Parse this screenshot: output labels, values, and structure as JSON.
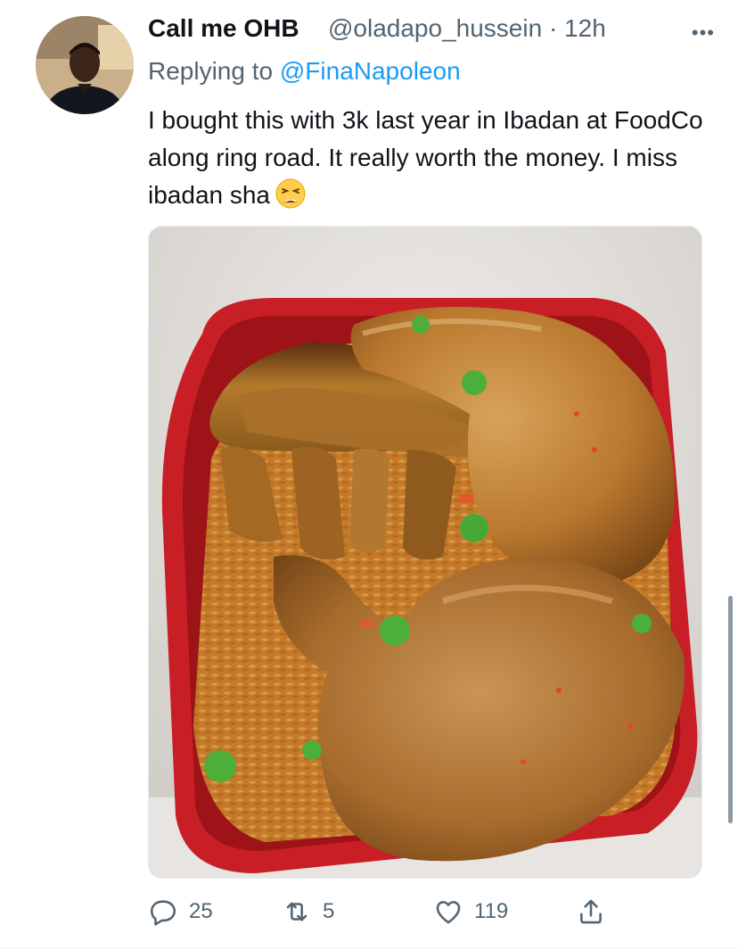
{
  "tweet": {
    "display_name": "Call me OHB",
    "handle_time": "@oladapo_hussein · 12h",
    "more_label": "•••",
    "reply_prefix": "Replying to ",
    "reply_mention": "@FinaNapoleon",
    "text": "I bought this with 3k last year in Ibadan at FoodCo along ring road. It really worth the money. I miss ibadan sha",
    "emoji": "weary-face-icon"
  },
  "actions": {
    "reply_count": "25",
    "retweet_count": "5",
    "like_count": "119"
  },
  "colors": {
    "text": "#0f1419",
    "secondary": "#536471",
    "link": "#1d9bf0"
  }
}
